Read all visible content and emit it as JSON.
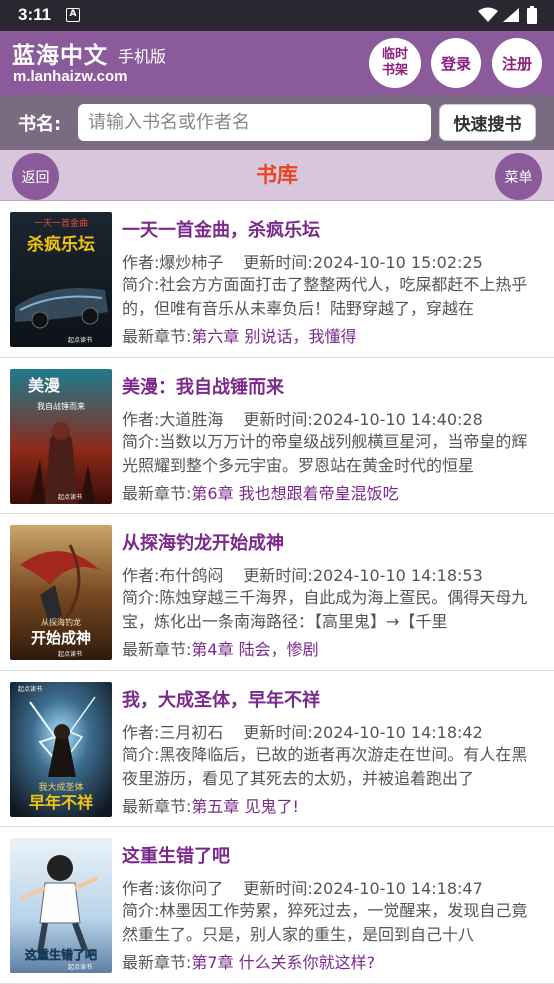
{
  "status": {
    "time": "3:11",
    "notif_letter": "A"
  },
  "header": {
    "site_name": "蓝海中文",
    "site_sub": "手机版",
    "domain": "m.lanhaizw.com",
    "btn_temp_line1": "临时",
    "btn_temp_line2": "书架",
    "btn_login": "登录",
    "btn_register": "注册"
  },
  "search": {
    "label": "书名:",
    "placeholder": "请输入书名或作者名",
    "button": "快速搜书"
  },
  "nav": {
    "back": "返回",
    "title": "书库",
    "menu": "菜单"
  },
  "labels": {
    "author": "作者:",
    "updated": "更新时间:",
    "intro": "简介:",
    "latest": "最新章节:"
  },
  "books": [
    {
      "title": "一天一首金曲，杀疯乐坛",
      "author": "爆炒柿子",
      "updated": "2024-10-10 15:02:25",
      "intro": "社会方方面面打击了整整两代人，吃屎都赶不上热乎的，但唯有音乐从未辜负后！陆野穿越了，穿越在",
      "latest": "第六章 别说话，我懂得",
      "cover_text": "杀疯乐坛",
      "cover_top": "一天一首金曲",
      "cover_pub": "起点读书"
    },
    {
      "title": "美漫：我自战锤而来",
      "author": "大道胜海",
      "updated": "2024-10-10 14:40:28",
      "intro": "当数以万万计的帝皇级战列舰横亘星河，当帝皇的辉光照耀到整个多元宇宙。罗恩站在黄金时代的恒星",
      "latest": "第6章 我也想跟着帝皇混饭吃",
      "cover_text": "美漫",
      "cover_top": "我自战锤而来",
      "cover_pub": "起点读书"
    },
    {
      "title": "从探海钓龙开始成神",
      "author": "布什鸽闷",
      "updated": "2024-10-10 14:18:53",
      "intro": "陈烛穿越三千海界，自此成为海上疍民。偶得天母九宝，炼化出一条南海路径：【高里鬼】→【千里",
      "latest": "第4章 陆会，惨剧",
      "cover_text": "开始成神",
      "cover_top": "从探海钓龙",
      "cover_pub": "起点读书"
    },
    {
      "title": "我，大成圣体，早年不祥",
      "author": "三月初石",
      "updated": "2024-10-10 14:18:42",
      "intro": "黑夜降临后，已故的逝者再次游走在世间。有人在黑夜里游历，看见了其死去的太奶，并被追着跑出了",
      "latest": "第五章 见鬼了!",
      "cover_text": "早年不祥",
      "cover_top": "我大成圣体",
      "cover_pub": "起点读书"
    },
    {
      "title": "这重生错了吧",
      "author": "该你问了",
      "updated": "2024-10-10 14:18:47",
      "intro": "林墨因工作劳累，猝死过去，一觉醒来，发现自己竟然重生了。只是，别人家的重生，是回到自己十八",
      "latest": "第7章 什么关系你就这样?",
      "cover_text": "这重生错了吧",
      "cover_top": "",
      "cover_pub": "起点读书"
    }
  ]
}
